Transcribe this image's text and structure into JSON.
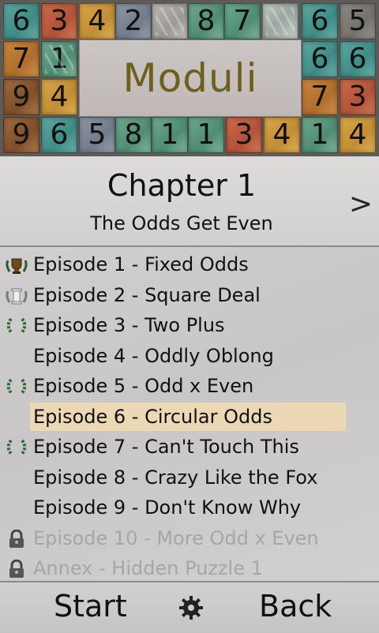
{
  "header": {
    "title": "Moduli",
    "top_row": [
      "6",
      "3",
      "4",
      "2",
      "",
      "8",
      "7",
      "",
      "6",
      "5"
    ],
    "left_rows": [
      [
        "7",
        "1"
      ],
      [
        "9",
        "4"
      ]
    ],
    "right_rows": [
      [
        "6",
        "6"
      ],
      [
        "7",
        "3"
      ]
    ],
    "bottom_row": [
      "9",
      "6",
      "5",
      "8",
      "1",
      "1",
      "3",
      "4",
      "1",
      "4"
    ]
  },
  "chapter": {
    "title": "Chapter 1",
    "subtitle": "The Odds Get Even",
    "next_label": ">"
  },
  "episodes": [
    {
      "label": "Episode 1 - Fixed Odds",
      "icon": "trophy-icon"
    },
    {
      "label": "Episode 2 - Square Deal",
      "icon": "column-icon"
    },
    {
      "label": "Episode 3 - Two Plus",
      "icon": "laurel-icon"
    },
    {
      "label": "Episode 4 - Oddly Oblong",
      "icon": ""
    },
    {
      "label": "Episode 5 - Odd x Even",
      "icon": "laurel-icon"
    },
    {
      "label": "Episode 6 - Circular Odds",
      "icon": "",
      "selected": true
    },
    {
      "label": "Episode 7 - Can't Touch This",
      "icon": "laurel-icon"
    },
    {
      "label": "Episode 8 - Crazy Like the Fox",
      "icon": ""
    },
    {
      "label": "Episode 9 - Don't Know Why",
      "icon": ""
    },
    {
      "label": "Episode 10 - More Odd x Even",
      "icon": "lock-icon",
      "locked": true
    },
    {
      "label": "Annex - Hidden Puzzle 1",
      "icon": "lock-icon",
      "locked": true
    }
  ],
  "footer": {
    "start_label": "Start",
    "back_label": "Back",
    "settings_icon": "gear-icon"
  },
  "colors": {
    "title_gold": "#6e5f1d",
    "selected_highlight": "#ecd8b4",
    "locked_text": "#a8a5a5"
  }
}
